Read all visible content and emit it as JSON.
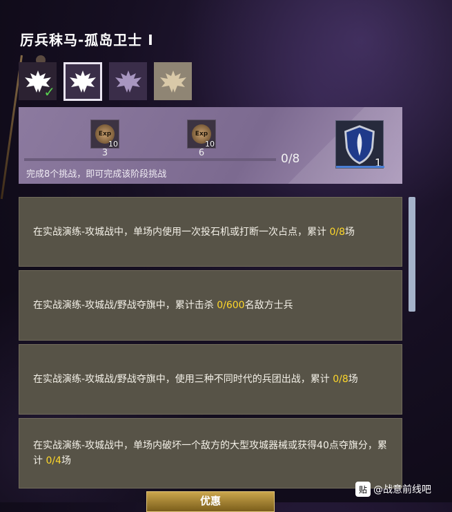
{
  "header": {
    "title": "厉兵秣马-孤岛卫士 Ⅰ"
  },
  "tiers": [
    {
      "name": "tier-1",
      "completed": true,
      "color": "#ffffff"
    },
    {
      "name": "tier-2",
      "selected": true,
      "color": "#ffffff"
    },
    {
      "name": "tier-3",
      "color": "#a896c0"
    },
    {
      "name": "tier-4",
      "color": "#d9c9a8"
    }
  ],
  "progress": {
    "rewards": [
      {
        "icon": "exp-icon",
        "badge": "Exp",
        "count": "10",
        "label": "3"
      },
      {
        "icon": "exp-icon",
        "badge": "Exp",
        "count": "10",
        "label": "6"
      }
    ],
    "value": 0,
    "max": 8,
    "text": "0/8",
    "hint": "完成8个挑战，即可完成该阶段挑战",
    "final_reward": {
      "icon": "shield-emblem-icon",
      "count": "1"
    }
  },
  "challenges": [
    {
      "pre": "在实战演练-攻城战中，单场内使用一次投石机或打断一次占点，累计 ",
      "value": "0/8",
      "post": "场"
    },
    {
      "pre": "在实战演练-攻城战/野战夺旗中，累计击杀 ",
      "value": "0/600",
      "post": "名敌方士兵"
    },
    {
      "pre": "在实战演练-攻城战/野战夺旗中，使用三种不同时代的兵团出战，累计 ",
      "value": "0/8",
      "post": "场"
    },
    {
      "pre": "在实战演练-攻城战中，单场内破坏一个敌方的大型攻城器械或获得40点夺旗分，累计 ",
      "value": "0/4",
      "post": "场"
    }
  ],
  "bottom_button": {
    "label": "优惠"
  },
  "watermark": {
    "logo": "贴",
    "text": "@战意前线吧"
  },
  "colors": {
    "highlight": "#ffd82a",
    "card_bg": "#575347",
    "panel": "#8c7a9f"
  }
}
